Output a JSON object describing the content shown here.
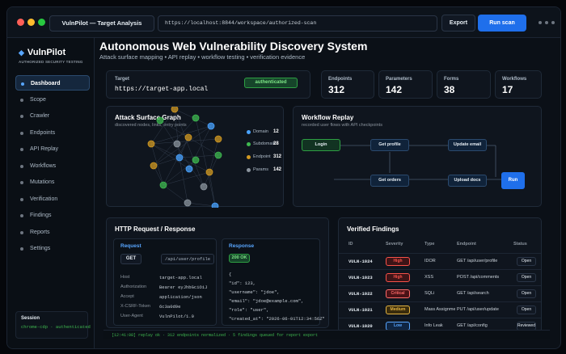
{
  "window": {
    "app_title": "VulnPilot — Target Analysis",
    "url": "https://localhost:8844/workspace/authorized-scan",
    "export_label": "Export",
    "run_scan_label": "Run scan"
  },
  "sidebar": {
    "brand": "VulnPilot",
    "tagline": "AUTHORIZED SECURITY TESTING",
    "items": [
      {
        "label": "Dashboard"
      },
      {
        "label": "Scope"
      },
      {
        "label": "Crawler"
      },
      {
        "label": "Endpoints"
      },
      {
        "label": "API Replay"
      },
      {
        "label": "Workflows"
      },
      {
        "label": "Mutations"
      },
      {
        "label": "Verification"
      },
      {
        "label": "Findings"
      },
      {
        "label": "Reports"
      },
      {
        "label": "Settings"
      }
    ],
    "session_label": "Session",
    "session_value": "chrome-cdp · authenticated"
  },
  "header": {
    "title": "Autonomous Web Vulnerability Discovery System",
    "subtitle": "Attack surface mapping • API replay • workflow testing • verification evidence"
  },
  "target": {
    "label": "Target",
    "value": "https://target-app.local",
    "badge": "authenticated"
  },
  "stats": [
    {
      "label": "Endpoints",
      "value": "312"
    },
    {
      "label": "Parameters",
      "value": "142"
    },
    {
      "label": "Forms",
      "value": "38"
    },
    {
      "label": "Workflows",
      "value": "17"
    }
  ],
  "graph": {
    "title": "Attack Surface Graph",
    "subtitle": "discovered nodes, links, entry points",
    "legend": [
      {
        "name": "Domain",
        "value": "12",
        "color": "#4aa3ff"
      },
      {
        "name": "Subdomain",
        "value": "28",
        "color": "#3fb950"
      },
      {
        "name": "Endpoint",
        "value": "312",
        "color": "#d29922"
      },
      {
        "name": "Params",
        "value": "142",
        "color": "#8b949e"
      }
    ]
  },
  "workflow": {
    "title": "Workflow Replay",
    "subtitle": "recorded user flows with API checkpoints",
    "nodes": {
      "login": "Login",
      "get_profile": "Get profile",
      "update_email": "Update email",
      "get_orders": "Get orders",
      "upload_docs": "Upload docs",
      "run": "Run"
    }
  },
  "http": {
    "title": "HTTP Request / Response",
    "request_label": "Request",
    "method": "GET",
    "path": "/api/user/profile",
    "headers": [
      {
        "key": "Host",
        "value": "target-app.local"
      },
      {
        "key": "Authorization",
        "value": "Bearer eyJhbGciOiJ"
      },
      {
        "key": "Accept",
        "value": "application/json"
      },
      {
        "key": "X-CSRF-Token",
        "value": "6c3a0d9e"
      },
      {
        "key": "User-Agent",
        "value": "VulnPilot/1.0"
      }
    ],
    "response_label": "Response",
    "status": "200 OK",
    "body_lines": [
      "{",
      "  \"id\": 123,",
      "  \"username\": \"jdoe\",",
      "  \"email\": \"jdoe@example.com\",",
      "  \"role\": \"user\",",
      "  \"created_at\": \"2026-06-01T12:34:56Z\""
    ]
  },
  "findings": {
    "title": "Verified Findings",
    "columns": [
      "ID",
      "Severity",
      "Type",
      "Endpoint",
      "Status"
    ],
    "rows": [
      {
        "id": "VULN-1024",
        "severity": "High",
        "type": "IDOR",
        "endpoint": "GET /api/user/profile",
        "status": "Open",
        "sev_color": "#f85149",
        "sev_bg": "#3d1417"
      },
      {
        "id": "VULN-1023",
        "severity": "High",
        "type": "XSS",
        "endpoint": "POST /api/comments",
        "status": "Open",
        "sev_color": "#f85149",
        "sev_bg": "#3d1417"
      },
      {
        "id": "VULN-1022",
        "severity": "Critical",
        "type": "SQLi",
        "endpoint": "GET /api/search",
        "status": "Open",
        "sev_color": "#ff6a69",
        "sev_bg": "#4a1216"
      },
      {
        "id": "VULN-1021",
        "severity": "Medium",
        "type": "Mass Assignment",
        "endpoint": "PUT /api/user/update",
        "status": "Open",
        "sev_color": "#e3b341",
        "sev_bg": "#3a2c0c"
      },
      {
        "id": "VULN-1020",
        "severity": "Low",
        "type": "Info Leak",
        "endpoint": "GET /api/config",
        "status": "Reviewed",
        "sev_color": "#58a6ff",
        "sev_bg": "#0f2542"
      }
    ]
  },
  "statusbar": "[12:41:08] replay ok · 312 endpoints normalized · 5 findings queued for report export"
}
